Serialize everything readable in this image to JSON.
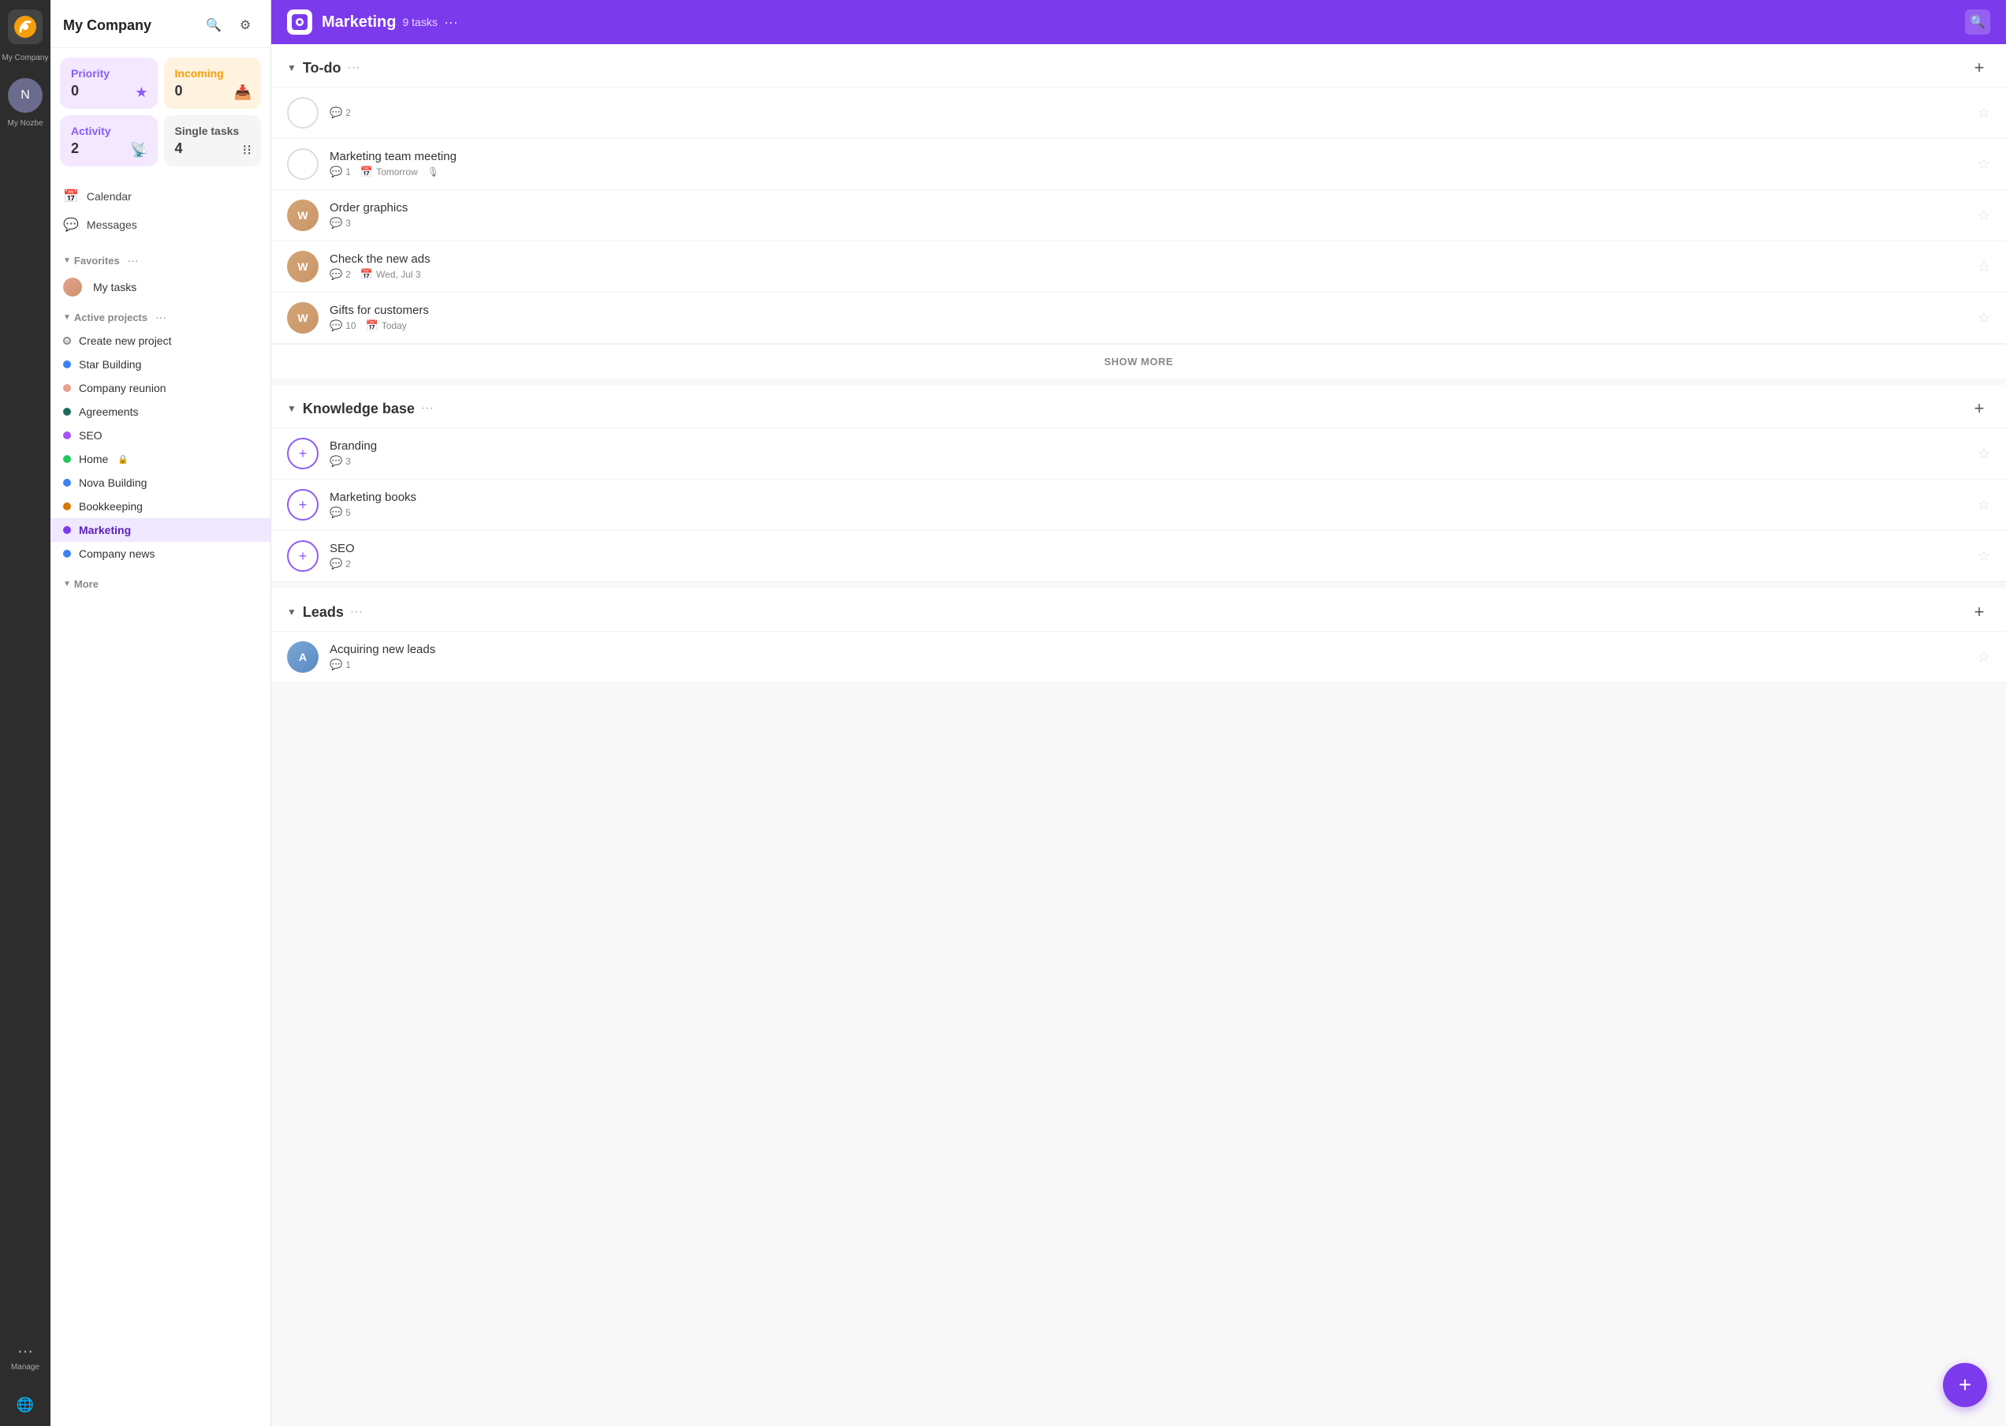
{
  "iconBar": {
    "appName": "My Company",
    "manageLabel": "Manage"
  },
  "sidebar": {
    "title": "My Company",
    "widgets": {
      "priority": {
        "label": "Priority",
        "count": "0"
      },
      "incoming": {
        "label": "Incoming",
        "count": "0"
      },
      "activity": {
        "label": "Activity",
        "count": "2"
      },
      "singleTasks": {
        "label": "Single tasks",
        "count": "4"
      }
    },
    "navItems": [
      {
        "icon": "📅",
        "label": "Calendar"
      },
      {
        "icon": "💬",
        "label": "Messages"
      }
    ],
    "favoritesLabel": "Favorites",
    "myTasksLabel": "My tasks",
    "activeProjectsLabel": "Active projects",
    "createProjectLabel": "Create new project",
    "projects": [
      {
        "name": "Star Building",
        "color": "#3b82f6"
      },
      {
        "name": "Company reunion",
        "color": "#e8a090"
      },
      {
        "name": "Agreements",
        "color": "#1a6b5a"
      },
      {
        "name": "SEO",
        "color": "#a855f7"
      },
      {
        "name": "Home",
        "color": "#22c55e",
        "locked": true
      },
      {
        "name": "Nova Building",
        "color": "#3b82f6"
      },
      {
        "name": "Bookkeeping",
        "color": "#d97706"
      },
      {
        "name": "Marketing",
        "color": "#7c3aed",
        "active": true
      },
      {
        "name": "Company news",
        "color": "#3b82f6"
      }
    ],
    "moreLabel": "More"
  },
  "topBar": {
    "title": "Marketing",
    "taskCount": "9 tasks",
    "searchIcon": "search"
  },
  "groups": [
    {
      "id": "todo",
      "title": "To-do",
      "tasks": [
        {
          "id": 1,
          "avatarType": "circle-outline",
          "commentCount": "2",
          "hasDate": false
        },
        {
          "id": 2,
          "title": "Marketing team meeting",
          "avatarType": "circle-outline",
          "commentCount": "1",
          "date": "Tomorrow",
          "hasMic": true
        },
        {
          "id": 3,
          "title": "Order graphics",
          "avatarType": "photo",
          "avatarColor": "#c9956a",
          "avatarInitial": "W",
          "commentCount": "3"
        },
        {
          "id": 4,
          "title": "Check the new ads",
          "avatarType": "photo",
          "avatarColor": "#c9956a",
          "avatarInitial": "W",
          "commentCount": "2",
          "date": "Wed, Jul 3"
        },
        {
          "id": 5,
          "title": "Gifts for customers",
          "avatarType": "photo",
          "avatarColor": "#c9956a",
          "avatarInitial": "W",
          "commentCount": "10",
          "date": "Today"
        }
      ],
      "showMore": "SHOW MORE"
    },
    {
      "id": "knowledge-base",
      "title": "Knowledge base",
      "tasks": [
        {
          "id": 6,
          "title": "Branding",
          "avatarType": "purple-plus",
          "commentCount": "3"
        },
        {
          "id": 7,
          "title": "Marketing books",
          "avatarType": "purple-plus",
          "commentCount": "5"
        },
        {
          "id": 8,
          "title": "SEO",
          "avatarType": "purple-plus",
          "commentCount": "2"
        }
      ]
    },
    {
      "id": "leads",
      "title": "Leads",
      "tasks": [
        {
          "id": 9,
          "title": "Acquiring new leads",
          "avatarType": "photo",
          "avatarColor": "#6b9bd4",
          "avatarInitial": "A",
          "commentCount": "1"
        }
      ]
    }
  ],
  "fab": {
    "label": "+"
  }
}
